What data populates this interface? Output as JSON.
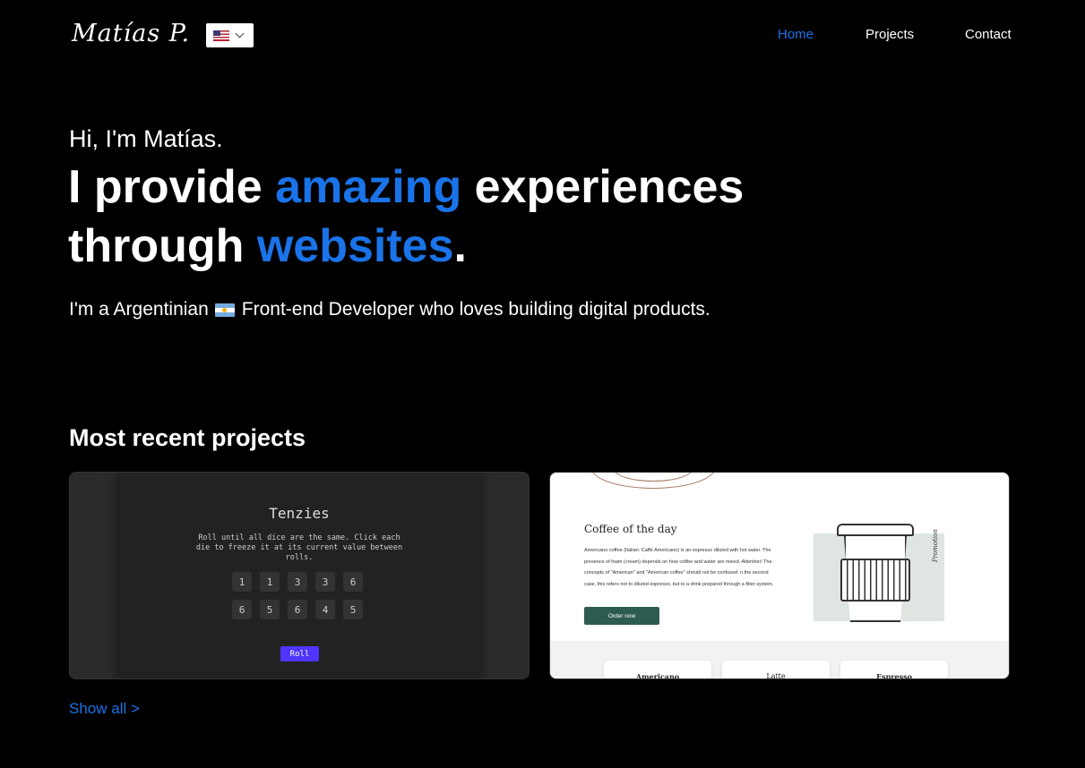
{
  "header": {
    "logo": "Matías P.",
    "language_flag": "us-flag-icon",
    "nav": [
      {
        "label": "Home",
        "active": true
      },
      {
        "label": "Projects",
        "active": false
      },
      {
        "label": "Contact",
        "active": false
      }
    ]
  },
  "hero": {
    "greeting": "Hi, I'm Matías.",
    "headline": {
      "part1": "I provide ",
      "highlight1": "amazing",
      "part2": " experiences through ",
      "highlight2": "websites",
      "part3": "."
    },
    "subtitle_before": "I'm a Argentinian",
    "subtitle_after": "Front-end Developer who loves building digital products."
  },
  "projects": {
    "title": "Most recent projects",
    "tenzies": {
      "title": "Tenzies",
      "description": "Roll until all dice are the same. Click each die to freeze it at its current value between rolls.",
      "dice": [
        "1",
        "1",
        "3",
        "3",
        "6",
        "6",
        "5",
        "6",
        "4",
        "5"
      ],
      "roll_label": "Roll"
    },
    "coffee": {
      "title": "Coffee of the day",
      "text": "Americano coffee (Italian: Caffè Americano) is an espresso diluted with hot water. The presence of foam (cream) depends on how coffee and water are mixed. Attention! The concepts of \"American\" and \"American coffee\" should not be confused: n the second case, this refers not to diluted espresso, but to a drink prepared through a filter system.",
      "button": "Order now",
      "side_label": "Promotion",
      "items": [
        "Americano",
        "Latte",
        "Espresso"
      ]
    },
    "show_all": "Show all >"
  },
  "colors": {
    "accent": "#1a73e8",
    "background": "#000000",
    "roll_button": "#5035ff",
    "coffee_button": "#2e5b50"
  }
}
